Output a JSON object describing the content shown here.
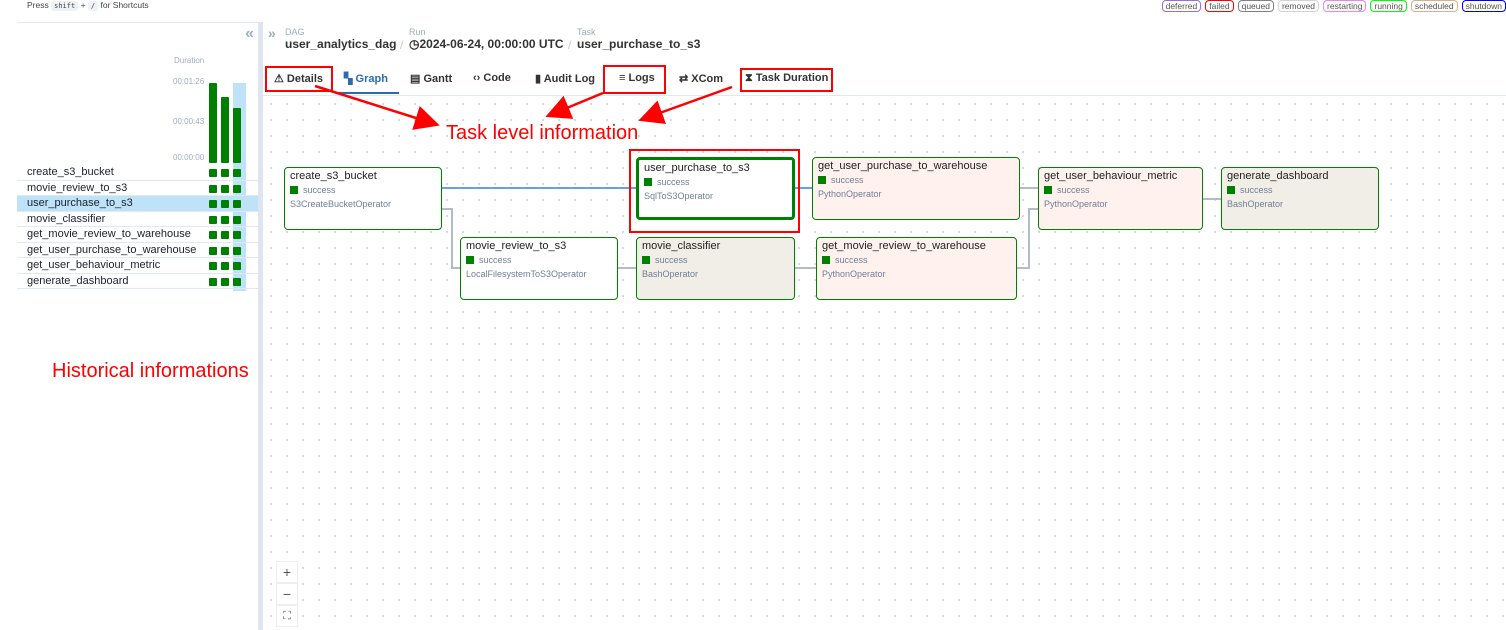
{
  "shortcuts": {
    "press": "Press",
    "key1": "shift",
    "plus": "+",
    "key2": "/",
    "suffix": "for Shortcuts"
  },
  "legend": [
    {
      "label": "deferred",
      "color": "#9370db"
    },
    {
      "label": "failed",
      "color": "#ff0000"
    },
    {
      "label": "queued",
      "color": "#808080"
    },
    {
      "label": "removed",
      "color": "#d3d3d3"
    },
    {
      "label": "restarting",
      "color": "#ee82ee"
    },
    {
      "label": "running",
      "color": "#00ff00"
    },
    {
      "label": "scheduled",
      "color": "#d2b48c"
    },
    {
      "label": "shutdown",
      "color": "#0000ff"
    }
  ],
  "grid": {
    "duration_label": "Duration",
    "ticks": [
      "00:01:26",
      "00:00:43",
      "00:00:00"
    ],
    "run_durations_fraction": [
      1.0,
      0.82,
      0.69
    ],
    "tasks": [
      "create_s3_bucket",
      "movie_review_to_s3",
      "user_purchase_to_s3",
      "movie_classifier",
      "get_movie_review_to_warehouse",
      "get_user_purchase_to_warehouse",
      "get_user_behaviour_metric",
      "generate_dashboard"
    ],
    "selected": "user_purchase_to_s3",
    "status_color": "#008000"
  },
  "breadcrumb": {
    "dag_label": "DAG",
    "dag": "user_analytics_dag",
    "run_label": "Run",
    "run": "2024-06-24, 00:00:00 UTC",
    "task_label": "Task",
    "task": "user_purchase_to_s3"
  },
  "tabs": [
    {
      "label": "Details",
      "icon": "warning-icon"
    },
    {
      "label": "Graph",
      "icon": "graph-icon",
      "active": true
    },
    {
      "label": "Gantt",
      "icon": "gantt-icon"
    },
    {
      "label": "Code",
      "icon": "code-icon"
    },
    {
      "label": "Audit Log",
      "icon": "document-icon"
    },
    {
      "label": "Logs",
      "icon": "list-icon"
    },
    {
      "label": "XCom",
      "icon": "arrows-icon"
    },
    {
      "label": "Task Duration",
      "icon": "hourglass-icon"
    }
  ],
  "nodes": [
    {
      "name": "create_s3_bucket",
      "status": "success",
      "operator": "S3CreateBucketOperator"
    },
    {
      "name": "movie_review_to_s3",
      "status": "success",
      "operator": "LocalFilesystemToS3Operator"
    },
    {
      "name": "user_purchase_to_s3",
      "status": "success",
      "operator": "SqlToS3Operator"
    },
    {
      "name": "movie_classifier",
      "status": "success",
      "operator": "BashOperator"
    },
    {
      "name": "get_user_purchase_to_warehouse",
      "status": "success",
      "operator": "PythonOperator"
    },
    {
      "name": "get_movie_review_to_warehouse",
      "status": "success",
      "operator": "PythonOperator"
    },
    {
      "name": "get_user_behaviour_metric",
      "status": "success",
      "operator": "PythonOperator"
    },
    {
      "name": "generate_dashboard",
      "status": "success",
      "operator": "BashOperator"
    }
  ],
  "annotations": {
    "task_level": "Task level information",
    "historical": "Historical informations"
  },
  "zoom": {
    "in": "+",
    "out": "−",
    "fit": "⛶"
  }
}
